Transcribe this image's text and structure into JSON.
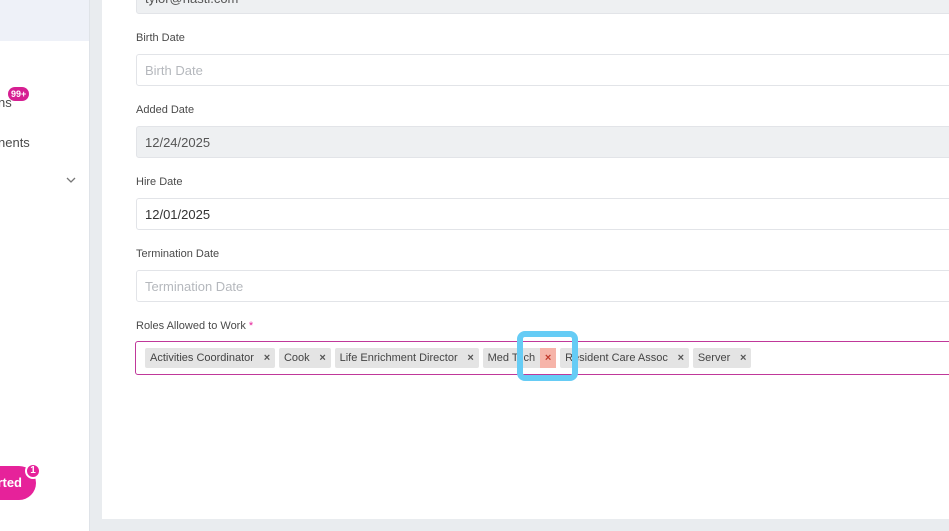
{
  "sidebar": {
    "items": [
      {
        "label": "ns",
        "badge": "99+"
      },
      {
        "label": "nents"
      }
    ],
    "started_button": {
      "label": "rted",
      "badge": "1"
    }
  },
  "form": {
    "email": {
      "value": "tylor@hasti.com"
    },
    "birth_date": {
      "label": "Birth Date",
      "placeholder": "Birth Date",
      "value": ""
    },
    "added_date": {
      "label": "Added Date",
      "value": "12/24/2025"
    },
    "hire_date": {
      "label": "Hire Date",
      "value": "12/01/2025"
    },
    "termination_date": {
      "label": "Termination Date",
      "placeholder": "Termination Date",
      "value": ""
    },
    "roles": {
      "label": "Roles Allowed to Work",
      "required_mark": "*",
      "tags": [
        {
          "label": "Activities Coordinator",
          "remove": "×"
        },
        {
          "label": "Cook",
          "remove": "×"
        },
        {
          "label": "Life Enrichment Director",
          "remove": "×"
        },
        {
          "label": "Med Tech",
          "remove": "×"
        },
        {
          "label": "Resident Care Assoc",
          "remove": "×"
        },
        {
          "label": "Server",
          "remove": "×"
        }
      ]
    }
  },
  "colors": {
    "accent": "#e6229a",
    "focus_border": "#c0389a",
    "highlight": "#66ccf5",
    "remove_hover": "#f6b4a9"
  }
}
